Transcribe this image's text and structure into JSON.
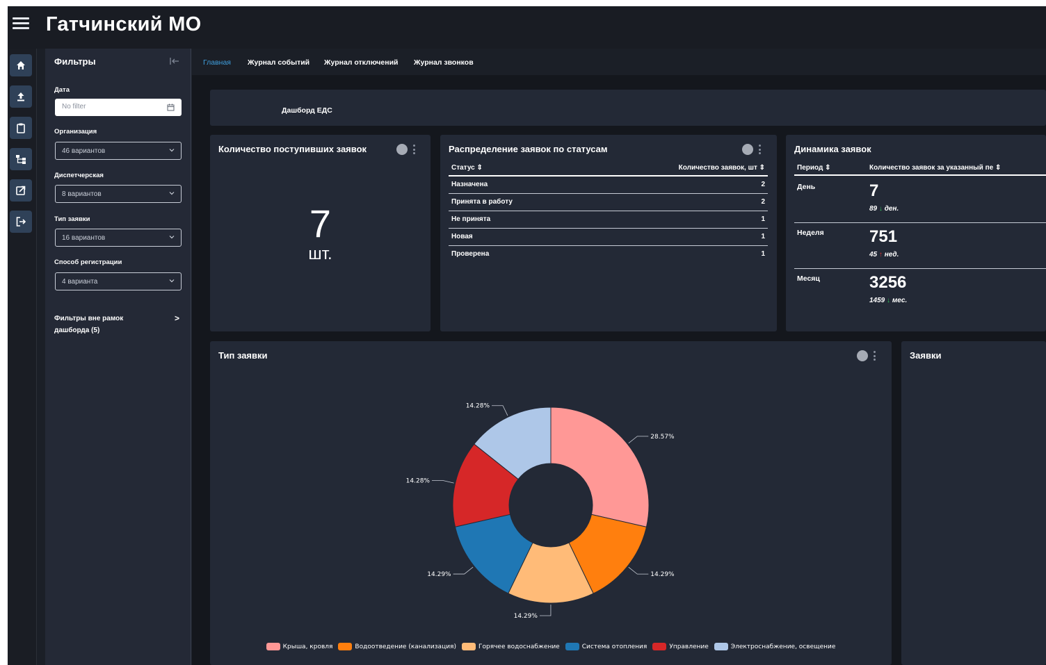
{
  "header": {
    "title": "Гатчинский МО"
  },
  "rail": {
    "items": [
      "home-icon",
      "upload-icon",
      "clipboard-icon",
      "hierarchy-icon",
      "external-link-icon",
      "logout-icon"
    ]
  },
  "filters": {
    "title": "Фильтры",
    "date": {
      "label": "Дата",
      "placeholder": "No filter"
    },
    "organization": {
      "label": "Организация",
      "value": "46 вариантов"
    },
    "dispatch": {
      "label": "Диспетчерская",
      "value": "8 вариантов"
    },
    "request_type": {
      "label": "Тип заявки",
      "value": "16 вариантов"
    },
    "registration": {
      "label": "Способ регистрации",
      "value": "4 варианта"
    },
    "outside_line1": "Фильтры вне рамок",
    "outside_line2": "дашборда (5)"
  },
  "tabs": [
    "Главная",
    "Журнал событий",
    "Журнал отключений",
    "Журнал звонков"
  ],
  "banner": {
    "title": "Дашборд ЕДС"
  },
  "count_card": {
    "title": "Количество поступивших заявок",
    "value": "7",
    "unit": "шт."
  },
  "status_card": {
    "title": "Распределение заявок по статусам",
    "columns": [
      "Статус ⇕",
      "Количество заявок, шт ⇕"
    ],
    "rows": [
      [
        "Назначена",
        "2"
      ],
      [
        "Принята в работу",
        "2"
      ],
      [
        "Не принята",
        "1"
      ],
      [
        "Новая",
        "1"
      ],
      [
        "Проверена",
        "1"
      ]
    ]
  },
  "dynamics_card": {
    "title": "Динамика заявок",
    "columns": [
      "Период ⇕",
      "Количество заявок за указанный пе ⇕"
    ],
    "rows": [
      {
        "period": "День",
        "value": "7",
        "prev": "89",
        "trend": "down",
        "unit": "ден."
      },
      {
        "period": "Неделя",
        "value": "751",
        "prev": "45",
        "trend": "up",
        "unit": "нед."
      },
      {
        "period": "Месяц",
        "value": "3256",
        "prev": "1459",
        "trend": "down",
        "unit": "мес."
      }
    ]
  },
  "type_card": {
    "title": "Тип заявки"
  },
  "requests_card": {
    "title": "Заявки"
  },
  "chart_data": {
    "type": "pie",
    "donut": true,
    "categories": [
      "Крыша, кровля",
      "Водоотведение (канализация)",
      "Горячее водоснабжение",
      "Система отопления",
      "Управление",
      "Электроснабжение, освещение"
    ],
    "values": [
      28.57,
      14.29,
      14.29,
      14.29,
      14.28,
      14.28
    ],
    "labels": [
      "28.57%",
      "14.29%",
      "14.29%",
      "14.29%",
      "14.28%",
      "14.28%"
    ],
    "colors": [
      "#ff9896",
      "#ff7f0e",
      "#ffbb78",
      "#1f77b4",
      "#d62728",
      "#aec7e8"
    ],
    "legend": "bottom"
  }
}
